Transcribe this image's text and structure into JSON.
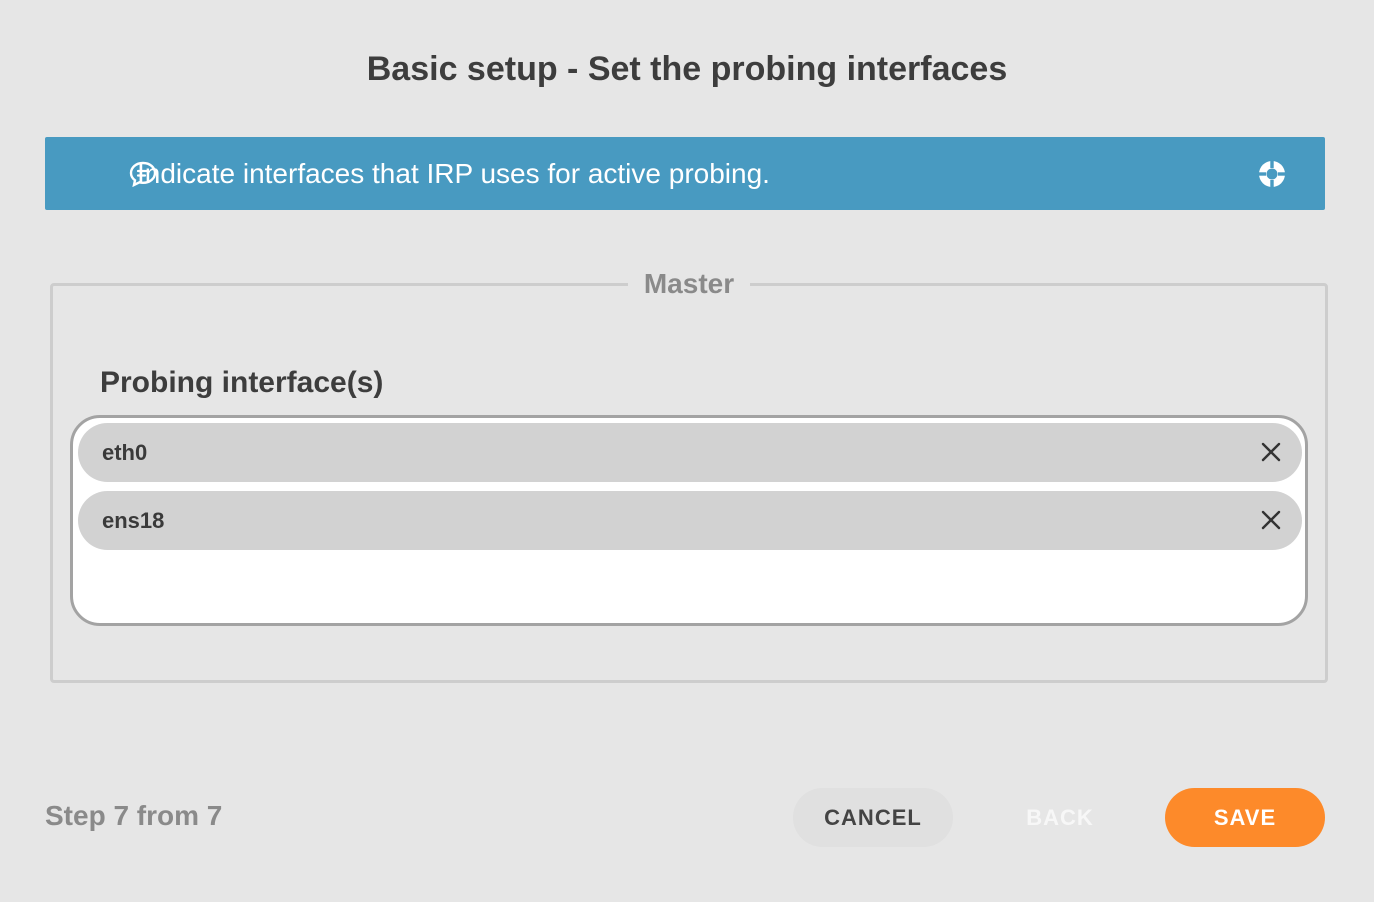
{
  "header": {
    "title": "Basic setup - Set the probing interfaces"
  },
  "info_banner": {
    "message": "Indicate interfaces that IRP uses for active probing.",
    "icon": "chat-bubble-icon",
    "help_icon": "lifebuoy-icon",
    "background": "#489ac1"
  },
  "section": {
    "legend": "Master",
    "field_label": "Probing interface(s)",
    "selected_interfaces": [
      {
        "label": "eth0"
      },
      {
        "label": "ens18"
      }
    ]
  },
  "footer": {
    "step_text": "Step 7 from 7",
    "cancel_label": "CANCEL",
    "back_label": "BACK",
    "save_label": "SAVE"
  },
  "colors": {
    "accent": "#fd8a2a",
    "info": "#489ac1"
  }
}
